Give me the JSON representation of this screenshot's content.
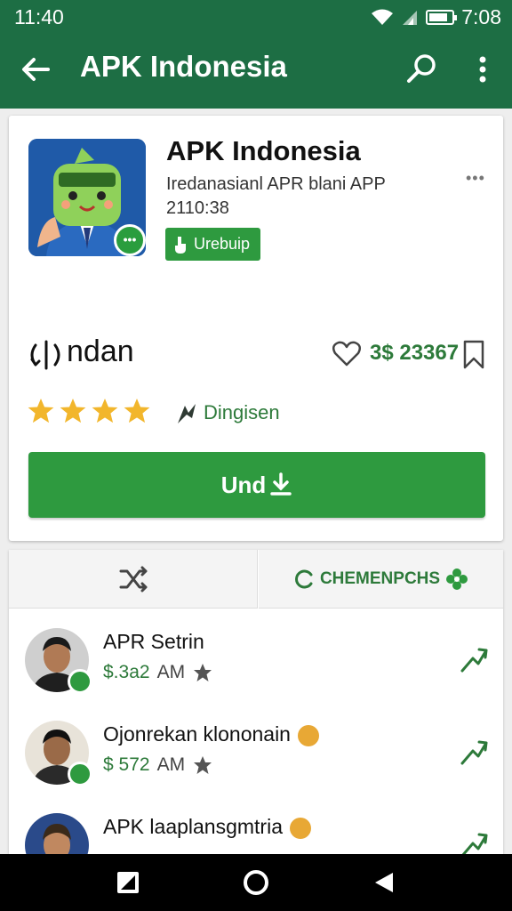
{
  "status_bar": {
    "time": "11:40",
    "battery_time": "7:08"
  },
  "toolbar": {
    "title": "APK Indonesia"
  },
  "app": {
    "name": "APK Indonesia",
    "subtitle": "Iredanasianl APR blani APP",
    "date": "2110:38",
    "tag": "Urebuip",
    "more": "•••",
    "section_label": "ndan",
    "price": "3$ 23367",
    "rating": 4,
    "category": "Dingisen",
    "download_label": "Und"
  },
  "tabs": {
    "right_label": "CHEMENPCHS"
  },
  "reviews": [
    {
      "name": "APR Setrin",
      "amount": "$.3a2",
      "time": "AM",
      "emoji": false
    },
    {
      "name": "Ojonrekan klononain",
      "amount": "$ 572",
      "time": "AM",
      "emoji": true
    },
    {
      "name": "APK laaplansgmtria",
      "amount": "",
      "time": "",
      "emoji": true
    }
  ],
  "colors": {
    "primary": "#1d6e44",
    "accent": "#2e9a3f",
    "star": "#f2b62c"
  }
}
